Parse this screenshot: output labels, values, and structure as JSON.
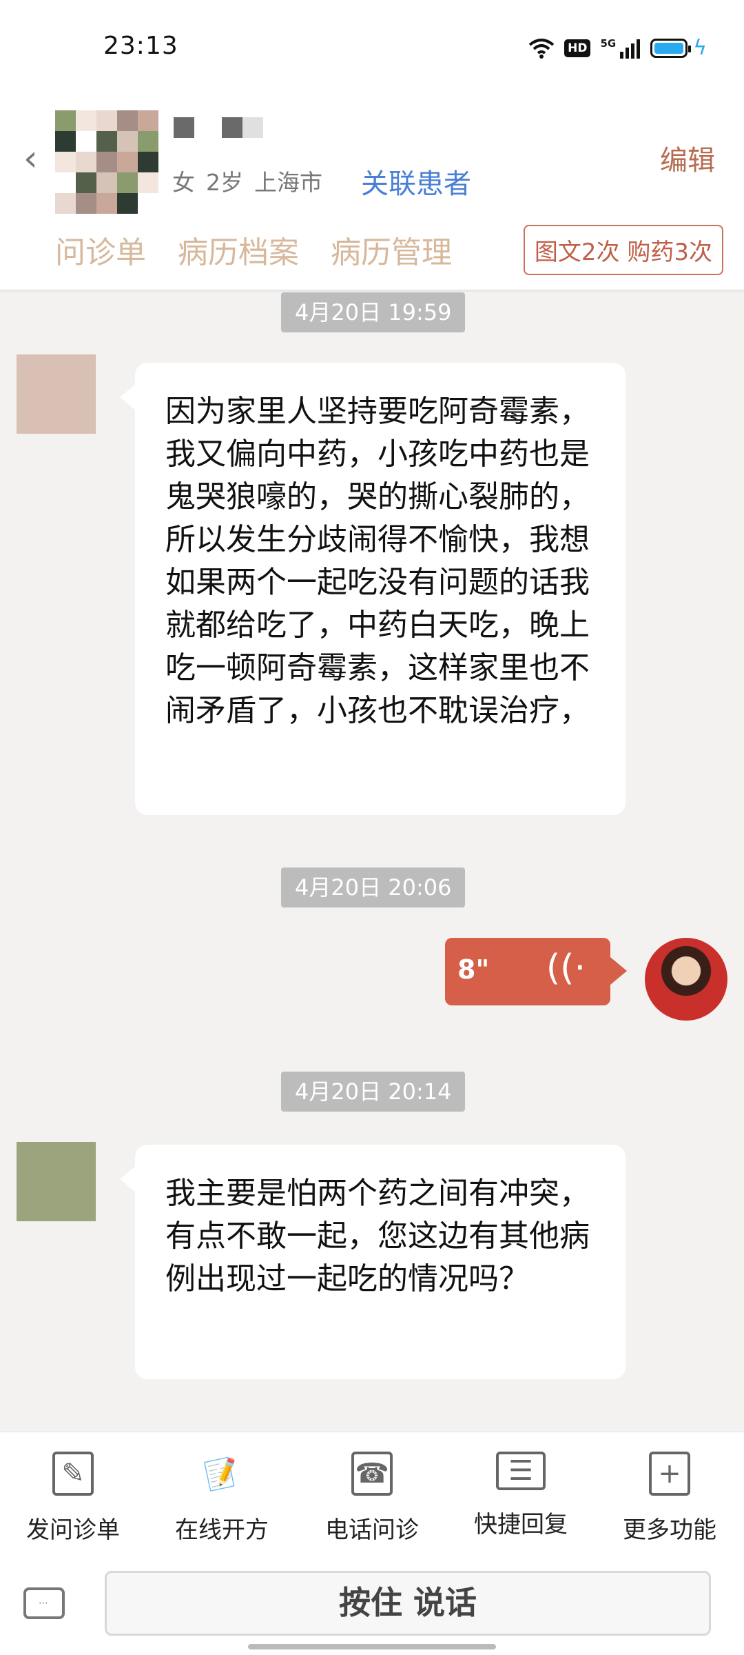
{
  "status_bar": {
    "time": "23:13",
    "hd": "HD",
    "network": "5G"
  },
  "header": {
    "patient_info": [
      "女",
      "2岁",
      "上海市"
    ],
    "link_patient": "关联患者",
    "edit": "编辑",
    "tabs": [
      "问诊单",
      "病历档案",
      "病历管理"
    ],
    "service_chip": "图文2次 购药3次"
  },
  "chat": {
    "messages": [
      {
        "timestamp": "4月20日 19:59",
        "sender": "patient",
        "text": "因为家里人坚持要吃阿奇霉素，我又偏向中药，小孩吃中药也是鬼哭狼嚎的，哭的撕心裂肺的，所以发生分歧闹得不愉快，我想如果两个一起吃没有问题的话我就都给吃了，中药白天吃，晚上吃一顿阿奇霉素，这样家里也不闹矛盾了，小孩也不耽误治疗，"
      },
      {
        "timestamp": "4月20日 20:06",
        "sender": "doctor",
        "voice_duration": "8\""
      },
      {
        "timestamp": "4月20日 20:14",
        "sender": "patient",
        "text": "我主要是怕两个药之间有冲突，有点不敢一起，您这边有其他病例出现过一起吃的情况吗？"
      }
    ]
  },
  "toolbar": {
    "items": [
      {
        "label": "发问诊单",
        "icon": "form-edit-icon"
      },
      {
        "label": "在线开方",
        "icon": "prescription-icon"
      },
      {
        "label": "电话问诊",
        "icon": "phone-icon"
      },
      {
        "label": "快捷回复",
        "icon": "quick-reply-icon"
      },
      {
        "label": "更多功能",
        "icon": "plus-icon"
      }
    ]
  },
  "input_bar": {
    "hold_to_talk": "按住 说话",
    "keyboard_icon": "keyboard-icon"
  },
  "colors": {
    "accent": "#4a7fd6",
    "brand": "#d65f49",
    "tab_text": "#d7b89b"
  }
}
